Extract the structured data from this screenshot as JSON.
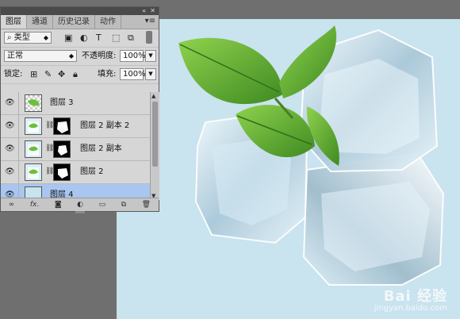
{
  "panel": {
    "tabs": [
      "图层",
      "通道",
      "历史记录",
      "动作"
    ],
    "active_tab": "图层",
    "filter": {
      "kind_label": "类型"
    },
    "blend_mode": "正常",
    "opacity_label": "不透明度:",
    "opacity_value": "100%",
    "lock_label": "锁定:",
    "fill_label": "填充:",
    "fill_value": "100%",
    "layers": [
      {
        "name": "图层 3",
        "selected": false,
        "has_mask": false
      },
      {
        "name": "图层 2 副本 2",
        "selected": false,
        "has_mask": true
      },
      {
        "name": "图层 2 副本",
        "selected": false,
        "has_mask": true
      },
      {
        "name": "图层 2",
        "selected": false,
        "has_mask": true
      },
      {
        "name": "图层 4",
        "selected": true,
        "has_mask": false
      }
    ],
    "bottom_icons": [
      "link-icon",
      "fx-icon",
      "mask-icon",
      "adjustment-icon",
      "folder-icon",
      "new-layer-icon",
      "trash-icon"
    ]
  },
  "canvas": {
    "background_color": "#c9e3ef",
    "watermark_brand": "Bai 经验",
    "watermark_url": "jingyan.baidu.com"
  },
  "colors": {
    "selection": "#a9c6f0",
    "mint": "#5fa83a"
  }
}
